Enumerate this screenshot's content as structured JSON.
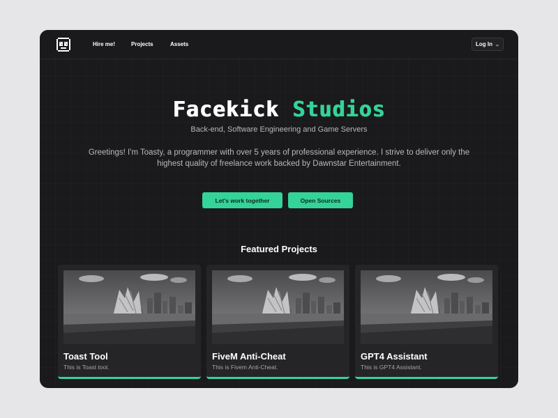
{
  "nav": {
    "logo_icon": "robot-face-icon",
    "links": [
      "Hire me!",
      "Projects",
      "Assets"
    ],
    "login_label": "Log In",
    "login_icon": "chevron-down-icon"
  },
  "hero": {
    "title_main": "Facekick",
    "title_accent": "Studios",
    "subtitle": "Back-end, Software Engineering and Game Servers",
    "intro": "Greetings! I'm Toasty, a programmer with over 5 years of professional experience. I strive to deliver only the highest quality of freelance work backed by Dawnstar Entertainment.",
    "cta_primary": "Let's work together",
    "cta_secondary": "Open Sources"
  },
  "featured": {
    "title": "Featured Projects",
    "cards": [
      {
        "title": "Toast Tool",
        "description": "This is Toast tool."
      },
      {
        "title": "FiveM Anti-Cheat",
        "description": "This is Fivem Anti-Cheat."
      },
      {
        "title": "GPT4 Assistant",
        "description": "This is GPT4 Assistant."
      }
    ]
  },
  "colors": {
    "accent": "#34d399",
    "background": "#1a1a1c",
    "card": "#252528"
  }
}
